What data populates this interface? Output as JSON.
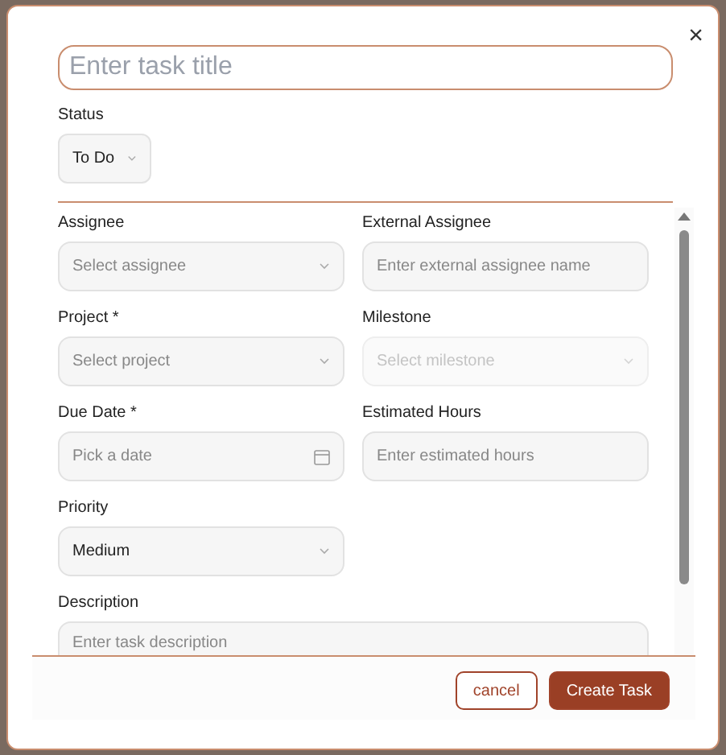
{
  "dialog": {
    "close": "×",
    "title_field": {
      "placeholder": "Enter task title"
    },
    "status": {
      "label": "Status",
      "value": "To Do"
    },
    "fields": [
      {
        "label": "Assignee",
        "kind": "select",
        "placeholder": "Select assignee",
        "disabled": false
      },
      {
        "label": "External Assignee",
        "kind": "input",
        "placeholder": "Enter external assignee name",
        "disabled": false
      },
      {
        "label": "Project *",
        "kind": "select",
        "placeholder": "Select project",
        "disabled": false
      },
      {
        "label": "Milestone",
        "kind": "select",
        "placeholder": "Select milestone",
        "disabled": true
      },
      {
        "label": "Due Date *",
        "kind": "date",
        "placeholder": "Pick a date",
        "disabled": false
      },
      {
        "label": "Estimated Hours",
        "kind": "input",
        "placeholder": "Enter estimated hours",
        "disabled": false
      },
      {
        "label": "Priority",
        "kind": "select",
        "value": "Medium",
        "disabled": false
      },
      {
        "label": "Description",
        "kind": "textarea",
        "placeholder": "Enter task description",
        "disabled": false
      }
    ],
    "buttons": {
      "cancel": "cancel",
      "create": "Create Task"
    }
  }
}
